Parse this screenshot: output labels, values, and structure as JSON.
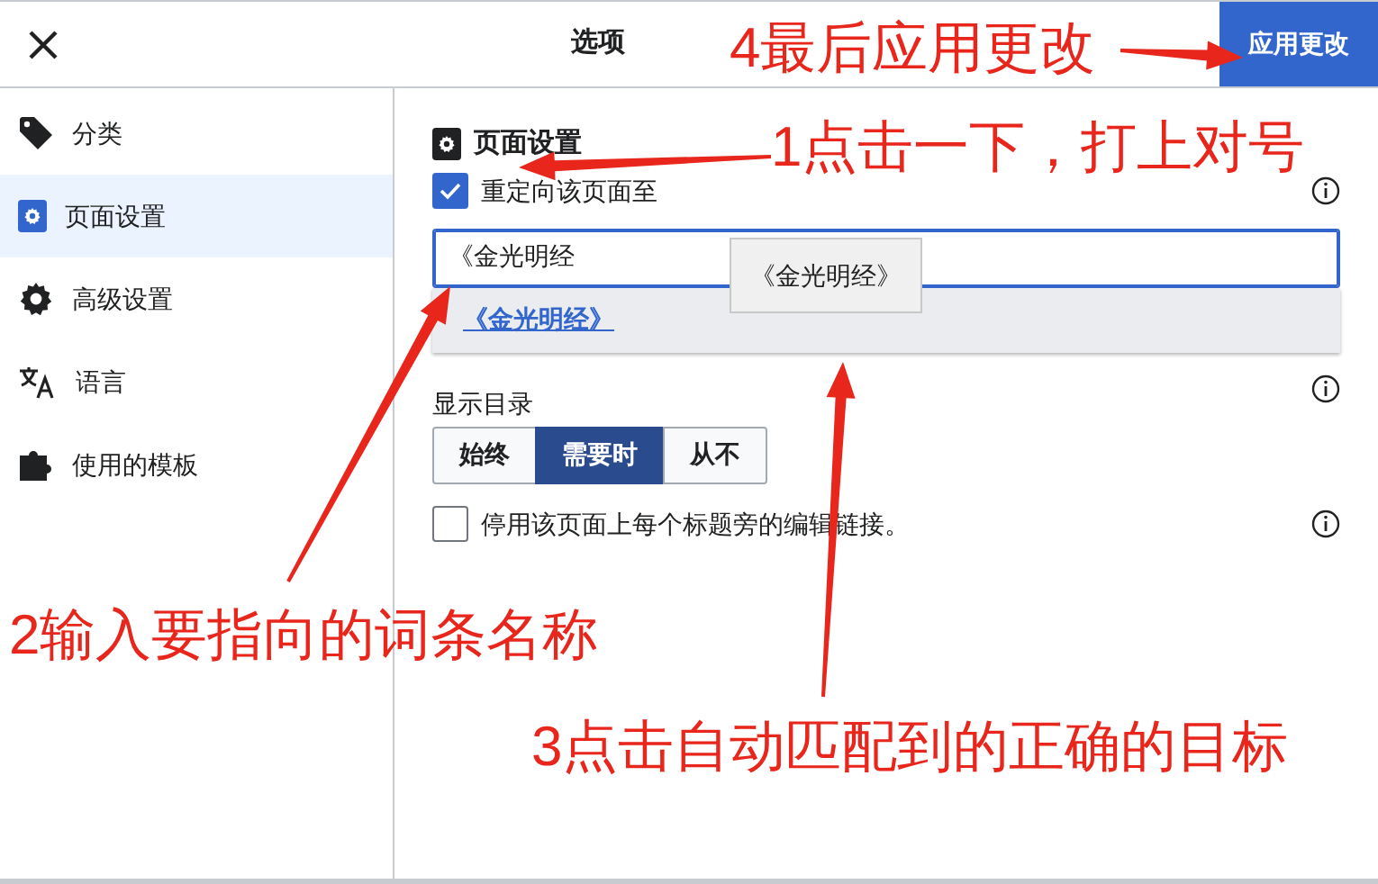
{
  "header": {
    "title": "选项",
    "apply_button": "应用更改"
  },
  "sidebar": {
    "items": [
      {
        "label": "分类",
        "kind": "tag",
        "selected": false
      },
      {
        "label": "页面设置",
        "kind": "settings",
        "selected": true
      },
      {
        "label": "高级设置",
        "kind": "gear",
        "selected": false
      },
      {
        "label": "语言",
        "kind": "language",
        "selected": false
      },
      {
        "label": "使用的模板",
        "kind": "puzzle",
        "selected": false
      }
    ]
  },
  "panel": {
    "heading": "页面设置",
    "redirect": {
      "label": "重定向该页面至",
      "checked": true
    },
    "redirect_field": {
      "value": "《金光明经"
    },
    "suggestions": [
      {
        "label": "《金光明经》"
      }
    ],
    "tooltip": "《金光明经》",
    "toc": {
      "label": "显示目录",
      "options": [
        {
          "label": "始终",
          "selected": false
        },
        {
          "label": "需要时",
          "selected": true
        },
        {
          "label": "从不",
          "selected": false
        }
      ]
    },
    "disable_edit_links": {
      "label": "停用该页面上每个标题旁的编辑链接。",
      "checked": false
    }
  },
  "annotations": [
    {
      "text": "4最后应用更改"
    },
    {
      "text": "1点击一下，打上对号"
    },
    {
      "text": "2输入要指向的词条名称"
    },
    {
      "text": "3点击自动匹配到的正确的目标"
    }
  ]
}
